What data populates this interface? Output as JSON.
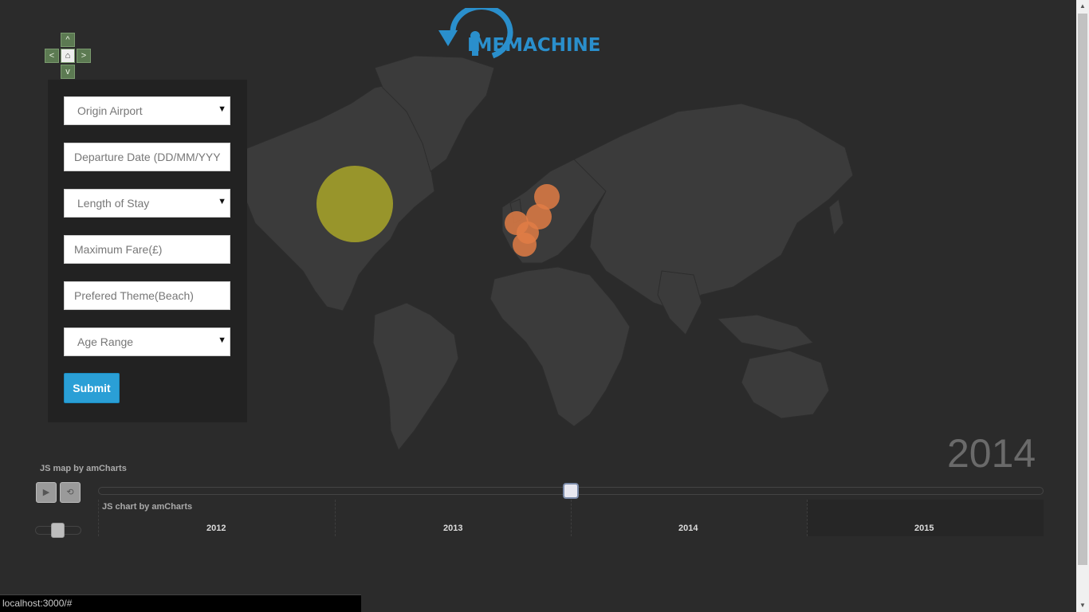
{
  "header": {
    "logo_text": "IMEMACHINE"
  },
  "nav_controls": {
    "up": "^",
    "left": "<",
    "home": "⌂",
    "right": ">",
    "down": "v"
  },
  "form": {
    "origin_airport": "Origin Airport",
    "departure_date_placeholder": "Departure Date (DD/MM/YYYY)",
    "length_of_stay": "Length of Stay",
    "max_fare_placeholder": "Maximum Fare(£)",
    "theme_placeholder": "Prefered Theme(Beach)",
    "age_range": "Age Range",
    "submit_label": "Submit",
    "caret": "▼"
  },
  "map": {
    "current_year": "2014",
    "credit": "JS map by amCharts",
    "bubble_colors": {
      "americas": "#a3a02a",
      "europe": "#e07c45"
    }
  },
  "player": {
    "play_icon": "▶",
    "loop_icon": "⟲",
    "chart_credit": "JS chart by amCharts",
    "years": [
      "2012",
      "2013",
      "2014",
      "2015"
    ]
  },
  "status": {
    "url": "localhost:3000/#"
  }
}
